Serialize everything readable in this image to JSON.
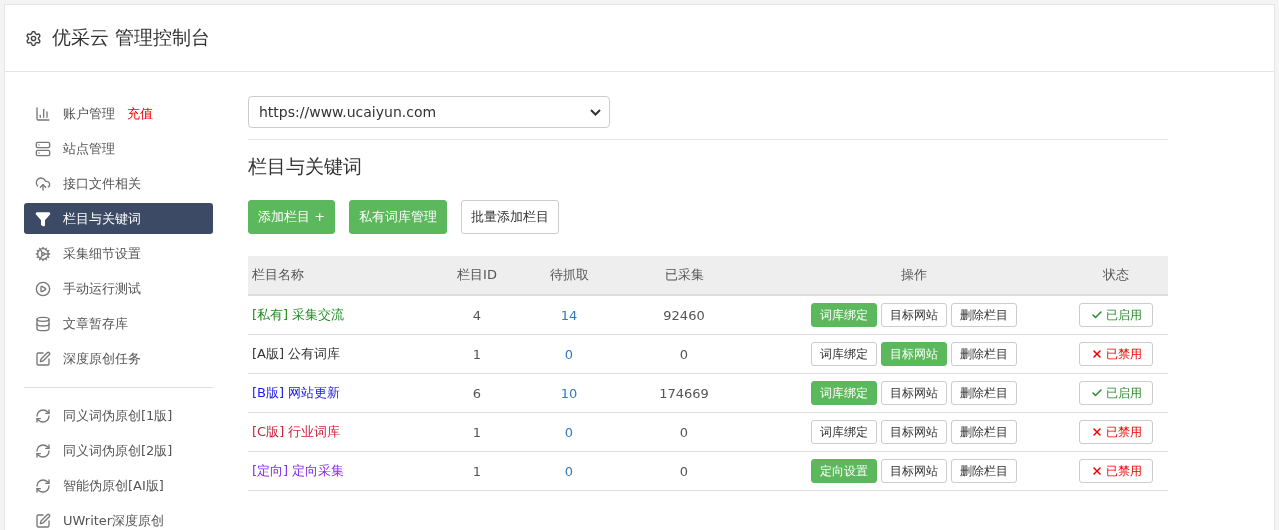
{
  "header": {
    "title": "优采云 管理控制台"
  },
  "sidebar": {
    "groups": [
      {
        "items": [
          {
            "label": "账户管理",
            "extra": "充值",
            "selected": false
          },
          {
            "label": "站点管理",
            "selected": false
          },
          {
            "label": "接口文件相关",
            "selected": false
          },
          {
            "label": "栏目与关键词",
            "selected": true
          },
          {
            "label": "采集细节设置",
            "selected": false
          },
          {
            "label": "手动运行测试",
            "selected": false
          },
          {
            "label": "文章暂存库",
            "selected": false
          },
          {
            "label": "深度原创任务",
            "selected": false
          }
        ]
      },
      {
        "items": [
          {
            "label": "同义词伪原创[1版]",
            "selected": false
          },
          {
            "label": "同义词伪原创[2版]",
            "selected": false
          },
          {
            "label": "智能伪原创[AI版]",
            "selected": false
          },
          {
            "label": "UWriter深度原创",
            "selected": false
          }
        ]
      }
    ]
  },
  "site_select": {
    "value": "https://www.ucaiyun.com"
  },
  "section_title": "栏目与关键词",
  "toolbar": [
    {
      "label": "添加栏目 +",
      "kind": "primary"
    },
    {
      "label": "私有词库管理",
      "kind": "primary"
    },
    {
      "label": "批量添加栏目",
      "kind": "default"
    }
  ],
  "table": {
    "columns": [
      "栏目名称",
      "栏目ID",
      "待抓取",
      "已采集",
      "操作",
      "状态"
    ],
    "rows": [
      {
        "tag": "[私有]",
        "name": "采集交流",
        "color": "#228b22",
        "col2": "4",
        "col3": "14",
        "col4": "92460",
        "actions": [
          {
            "label": "词库绑定",
            "selected": true
          },
          {
            "label": "目标网站",
            "selected": false
          },
          {
            "label": "删除栏目",
            "selected": false
          }
        ],
        "status": {
          "enabled": true,
          "label": "已启用"
        }
      },
      {
        "tag": "[A版]",
        "name": "公有词库",
        "color": "#333333",
        "col2": "1",
        "col3": "0",
        "col4": "0",
        "actions": [
          {
            "label": "词库绑定",
            "selected": false
          },
          {
            "label": "目标网站",
            "selected": true
          },
          {
            "label": "删除栏目",
            "selected": false
          }
        ],
        "status": {
          "enabled": false,
          "label": "已禁用"
        }
      },
      {
        "tag": "[B版]",
        "name": "网站更新",
        "color": "#1a1aee",
        "col2": "6",
        "col3": "10",
        "col4": "174669",
        "actions": [
          {
            "label": "词库绑定",
            "selected": true
          },
          {
            "label": "目标网站",
            "selected": false
          },
          {
            "label": "删除栏目",
            "selected": false
          }
        ],
        "status": {
          "enabled": true,
          "label": "已启用"
        }
      },
      {
        "tag": "[C版]",
        "name": "行业词库",
        "color": "#d0203a",
        "col2": "1",
        "col3": "0",
        "col4": "0",
        "actions": [
          {
            "label": "词库绑定",
            "selected": false
          },
          {
            "label": "目标网站",
            "selected": false
          },
          {
            "label": "删除栏目",
            "selected": false
          }
        ],
        "status": {
          "enabled": false,
          "label": "已禁用"
        }
      },
      {
        "tag": "[定向]",
        "name": "定向采集",
        "color": "#8a2be2",
        "col2": "1",
        "col3": "0",
        "col4": "0",
        "actions": [
          {
            "label": "定向设置",
            "selected": true
          },
          {
            "label": "目标网站",
            "selected": false
          },
          {
            "label": "删除栏目",
            "selected": false
          }
        ],
        "status": {
          "enabled": false,
          "label": "已禁用"
        }
      }
    ]
  }
}
